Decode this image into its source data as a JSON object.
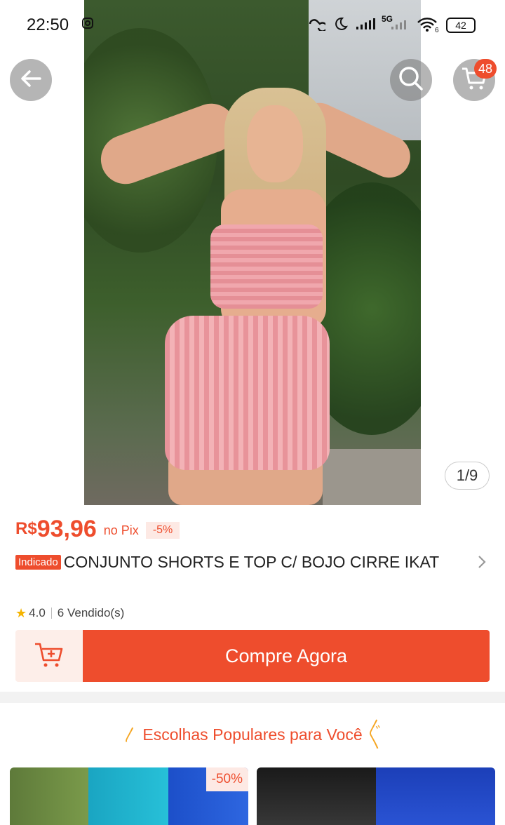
{
  "status_bar": {
    "time": "22:50",
    "network": "5G",
    "wifi_level": "6",
    "battery": "42"
  },
  "header": {
    "cart_count": "48"
  },
  "gallery": {
    "pager": "1/9"
  },
  "product": {
    "currency": "R$",
    "price": "93,96",
    "payment_note": "no Pix",
    "discount": "-5%",
    "tag": "Indicado",
    "title": "CONJUNTO SHORTS E TOP C/ BOJO CIRRE  IKAT",
    "rating": "4.0",
    "sold": "6 Vendido(s)"
  },
  "actions": {
    "buy_now": "Compre Agora"
  },
  "recommendations": {
    "title": "Escolhas Populares para Você",
    "items": [
      {
        "discount": "-50%"
      },
      {
        "discount": ""
      }
    ]
  },
  "colors": {
    "accent": "#ee4d2d",
    "accent_light": "#fdeee9",
    "star": "#f5b400"
  }
}
